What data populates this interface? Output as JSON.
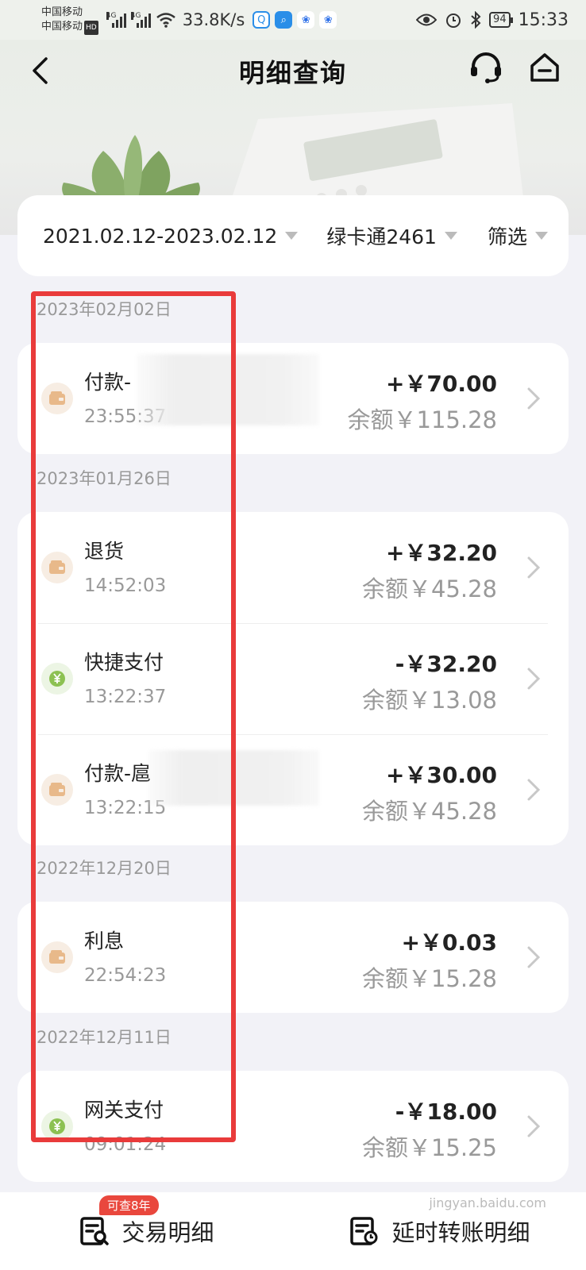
{
  "status_bar": {
    "carrier_1": "中国移动",
    "carrier_2": "中国移动",
    "hd": "HD",
    "net_1": "4G",
    "net_2": "4G",
    "speed": "33.8K/s",
    "battery": "94",
    "time": "15:33"
  },
  "header": {
    "title": "明细查询",
    "back_icon": "chevron-left-icon",
    "service_icon": "headset-icon",
    "home_icon": "home-icon"
  },
  "filters": {
    "date_range": "2021.02.12-2023.02.12",
    "card": "绿卡通2461",
    "screen": "筛选"
  },
  "groups": [
    {
      "date": "2023年02月02日",
      "items": [
        {
          "name": "付款-",
          "time": "23:55:37",
          "amount": "+￥70.00",
          "balance": "余额￥115.28",
          "icon": "wallet-icon",
          "blurred": true
        }
      ]
    },
    {
      "date": "2023年01月26日",
      "items": [
        {
          "name": "退货",
          "time": "14:52:03",
          "amount": "+￥32.20",
          "balance": "余额￥45.28",
          "icon": "wallet-icon"
        },
        {
          "name": "快捷支付",
          "time": "13:22:37",
          "amount": "-￥32.20",
          "balance": "余额￥13.08",
          "icon": "yuan-icon"
        },
        {
          "name": "付款-扈",
          "time": "13:22:15",
          "amount": "+￥30.00",
          "balance": "余额￥45.28",
          "icon": "wallet-icon",
          "blurred": true
        }
      ]
    },
    {
      "date": "2022年12月20日",
      "items": [
        {
          "name": "利息",
          "time": "22:54:23",
          "amount": "+￥0.03",
          "balance": "余额￥15.28",
          "icon": "wallet-icon"
        }
      ]
    },
    {
      "date": "2022年12月11日",
      "items": [
        {
          "name": "网关支付",
          "time": "09:01:24",
          "amount": "-￥18.00",
          "balance": "余额￥15.25",
          "icon": "yuan-icon"
        }
      ]
    }
  ],
  "bottom_tabs": {
    "badge": "可查8年",
    "tab_1": "交易明细",
    "tab_2": "延时转账明细"
  },
  "watermark": "jingyan.baidu.com",
  "colors": {
    "accent_red": "#e93b3b",
    "wallet_icon": "#e8b98a",
    "yuan_icon": "#8cc152",
    "page_bg": "#f2f2f7"
  }
}
